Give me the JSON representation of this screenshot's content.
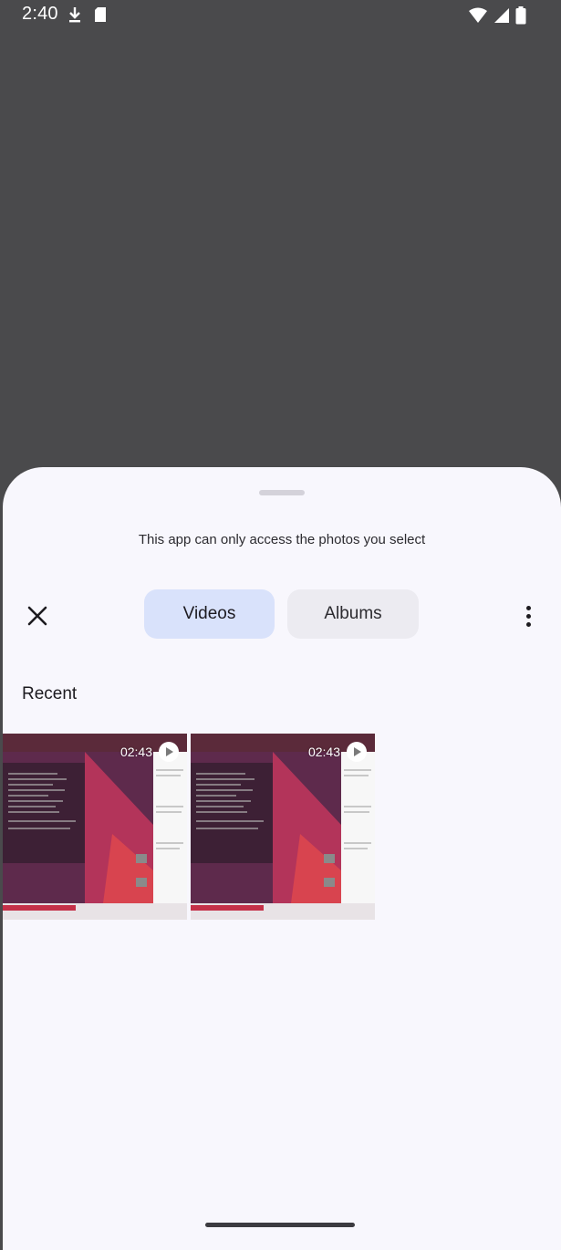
{
  "status_bar": {
    "time": "2:40",
    "left_icons": [
      "download-icon",
      "sd-card-icon"
    ],
    "right_icons": [
      "wifi-icon",
      "cell-signal-icon",
      "battery-icon"
    ]
  },
  "picker": {
    "access_message": "This app can only access the photos you select",
    "close_icon": "close-icon",
    "tabs": [
      {
        "label": "Videos",
        "selected": true
      },
      {
        "label": "Albums",
        "selected": false
      }
    ],
    "more_icon": "more-vert-icon",
    "section_title": "Recent",
    "videos": [
      {
        "duration": "02:43",
        "icon": "play-icon"
      },
      {
        "duration": "02:43",
        "icon": "play-icon"
      }
    ]
  },
  "colors": {
    "selected_tab": "#d9e2fb",
    "unselected_tab": "#ecebf1",
    "sheet_background": "#f8f7fd",
    "scrim": "#4a4a4c"
  }
}
